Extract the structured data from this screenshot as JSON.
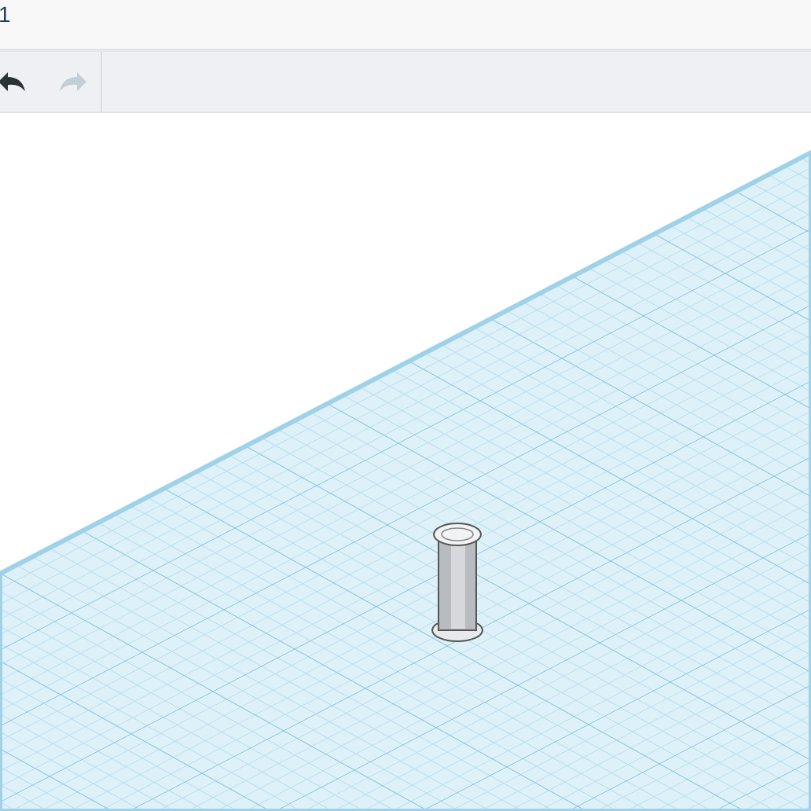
{
  "title": "1",
  "toolbar": [
    {
      "kind": "undo",
      "disabled": false
    },
    {
      "kind": "redo",
      "disabled": true
    }
  ]
}
